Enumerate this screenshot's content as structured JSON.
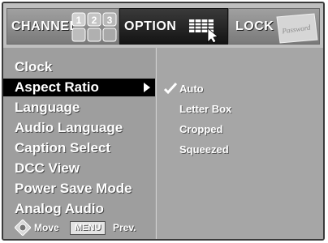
{
  "tabs": {
    "channel": "CHANNEL",
    "option": "OPTION",
    "lock": "LOCK",
    "keypad_digits": [
      "1",
      "2",
      "3"
    ],
    "lock_watermark": "Password",
    "active": "OPTION"
  },
  "menu": {
    "items": [
      {
        "label": "Clock",
        "selected": false
      },
      {
        "label": "Aspect Ratio",
        "selected": true
      },
      {
        "label": "Language",
        "selected": false
      },
      {
        "label": "Audio Language",
        "selected": false
      },
      {
        "label": "Caption Select",
        "selected": false
      },
      {
        "label": "DCC View",
        "selected": false
      },
      {
        "label": "Power Save Mode",
        "selected": false
      },
      {
        "label": "Analog Audio",
        "selected": false
      }
    ]
  },
  "options": {
    "items": [
      {
        "label": "Auto",
        "checked": true
      },
      {
        "label": "Letter Box",
        "checked": false
      },
      {
        "label": "Cropped",
        "checked": false
      },
      {
        "label": "Squeezed",
        "checked": false
      }
    ]
  },
  "footer": {
    "move": "Move",
    "menu_key": "MENU",
    "prev": "Prev."
  },
  "colors": {
    "panel": "#a6a6a6",
    "selected_bg": "#000000",
    "text": "#ffffff",
    "active_tab": "#1a1a1a"
  }
}
